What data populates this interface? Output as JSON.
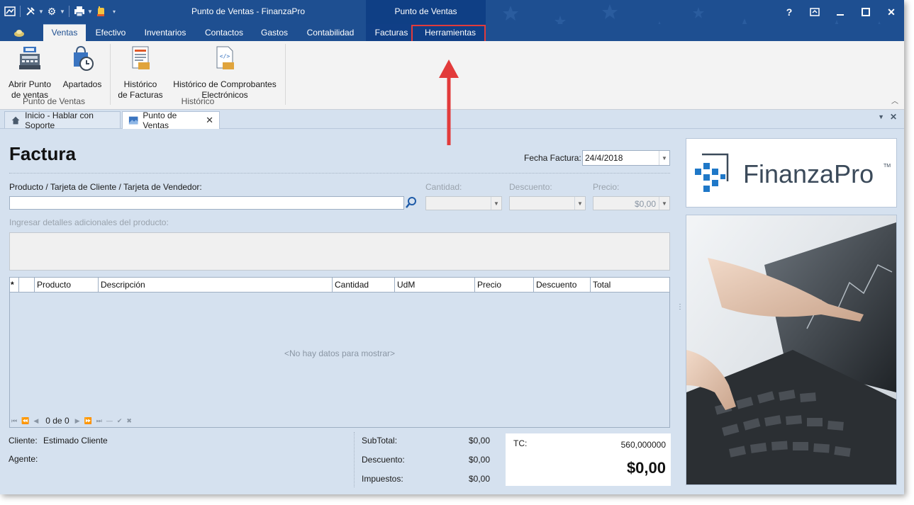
{
  "window": {
    "title": "Punto de Ventas - FinanzaPro",
    "context_title": "Punto de Ventas"
  },
  "ribbon": {
    "tabs": [
      "Ventas",
      "Efectivo",
      "Inventarios",
      "Contactos",
      "Gastos",
      "Contabilidad",
      "Facturas",
      "Herramientas"
    ],
    "active_tab": "Ventas",
    "groups": [
      {
        "label": "Punto de Ventas",
        "buttons": [
          "Abrir Punto\nde ventas",
          "Apartados"
        ]
      },
      {
        "label": "Histórico",
        "buttons": [
          "Histórico\nde Facturas",
          "Histórico de Comprobantes\nElectrónicos"
        ]
      }
    ]
  },
  "doc_tabs": [
    "Inicio - Hablar con Soporte",
    "Punto de Ventas"
  ],
  "form": {
    "heading": "Factura",
    "fecha_label": "Fecha Factura:",
    "fecha_value": "24/4/2018",
    "producto_label": "Producto / Tarjeta de Cliente / Tarjeta de Vendedor:",
    "producto_value": "",
    "cantidad_label": "Cantidad:",
    "descuento_label": "Descuento:",
    "precio_label": "Precio:",
    "precio_value": "$0,00",
    "detalles_label": "Ingresar detalles adicionales del producto:"
  },
  "grid": {
    "star": "*",
    "columns": [
      "Producto",
      "Descripción",
      "Cantidad",
      "UdM",
      "Precio",
      "Descuento",
      "Total"
    ],
    "rows": [],
    "empty_message": "<No hay datos para mostrar>",
    "pager": "0 de 0"
  },
  "footer": {
    "cliente_label": "Cliente:",
    "cliente_value": "Estimado Cliente",
    "agente_label": "Agente:",
    "agente_value": "",
    "subtotal_label": "SubTotal:",
    "subtotal_value": "$0,00",
    "descuento_label": "Descuento:",
    "descuento_value": "$0,00",
    "impuestos_label": "Impuestos:",
    "impuestos_value": "$0,00",
    "tc_label": "TC:",
    "tc_value": "560,000000",
    "total_value": "$0,00"
  },
  "brand": {
    "logo_text": "FinanzaPro",
    "trademark": "TM"
  },
  "colors": {
    "title_bar": "#1e4f91",
    "context_tab": "#0f3f85",
    "accent": "#1e4f91",
    "highlight": "#e23b3b",
    "logo_text": "#3b4a5a",
    "logo_blue": "#1f78c8"
  }
}
